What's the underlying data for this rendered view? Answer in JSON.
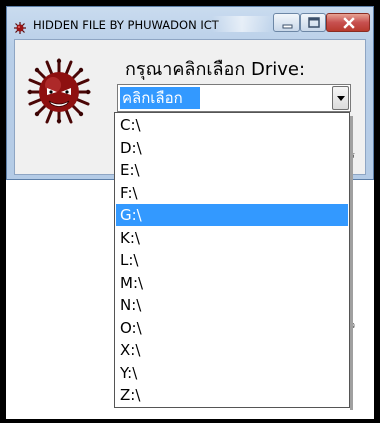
{
  "window": {
    "title": "HIDDEN FILE BY PHUWADON ICT"
  },
  "main": {
    "prompt_label": "กรุณาคลิกเลือก Drive:",
    "drive_combo": {
      "value": "คลิกเลือก",
      "options": [
        "C:\\",
        "D:\\",
        "E:\\",
        "F:\\",
        "G:\\",
        "K:\\",
        "L:\\",
        "M:\\",
        "N:\\",
        "O:\\",
        "X:\\",
        "Y:\\",
        "Z:\\"
      ],
      "highlighted": "G:\\"
    },
    "clipped_text_right": "คร",
    "clipped_text_right2": "ว"
  },
  "colors": {
    "selection": "#3399ff",
    "title_gradient": "#c9dbef",
    "close_button": "#c75050"
  },
  "icons": {
    "app": "virus-icon",
    "logo": "angry-virus-mascot",
    "minimize": "minimize-icon",
    "maximize": "maximize-icon",
    "close": "close-icon",
    "combo_arrow": "chevron-down-icon"
  }
}
